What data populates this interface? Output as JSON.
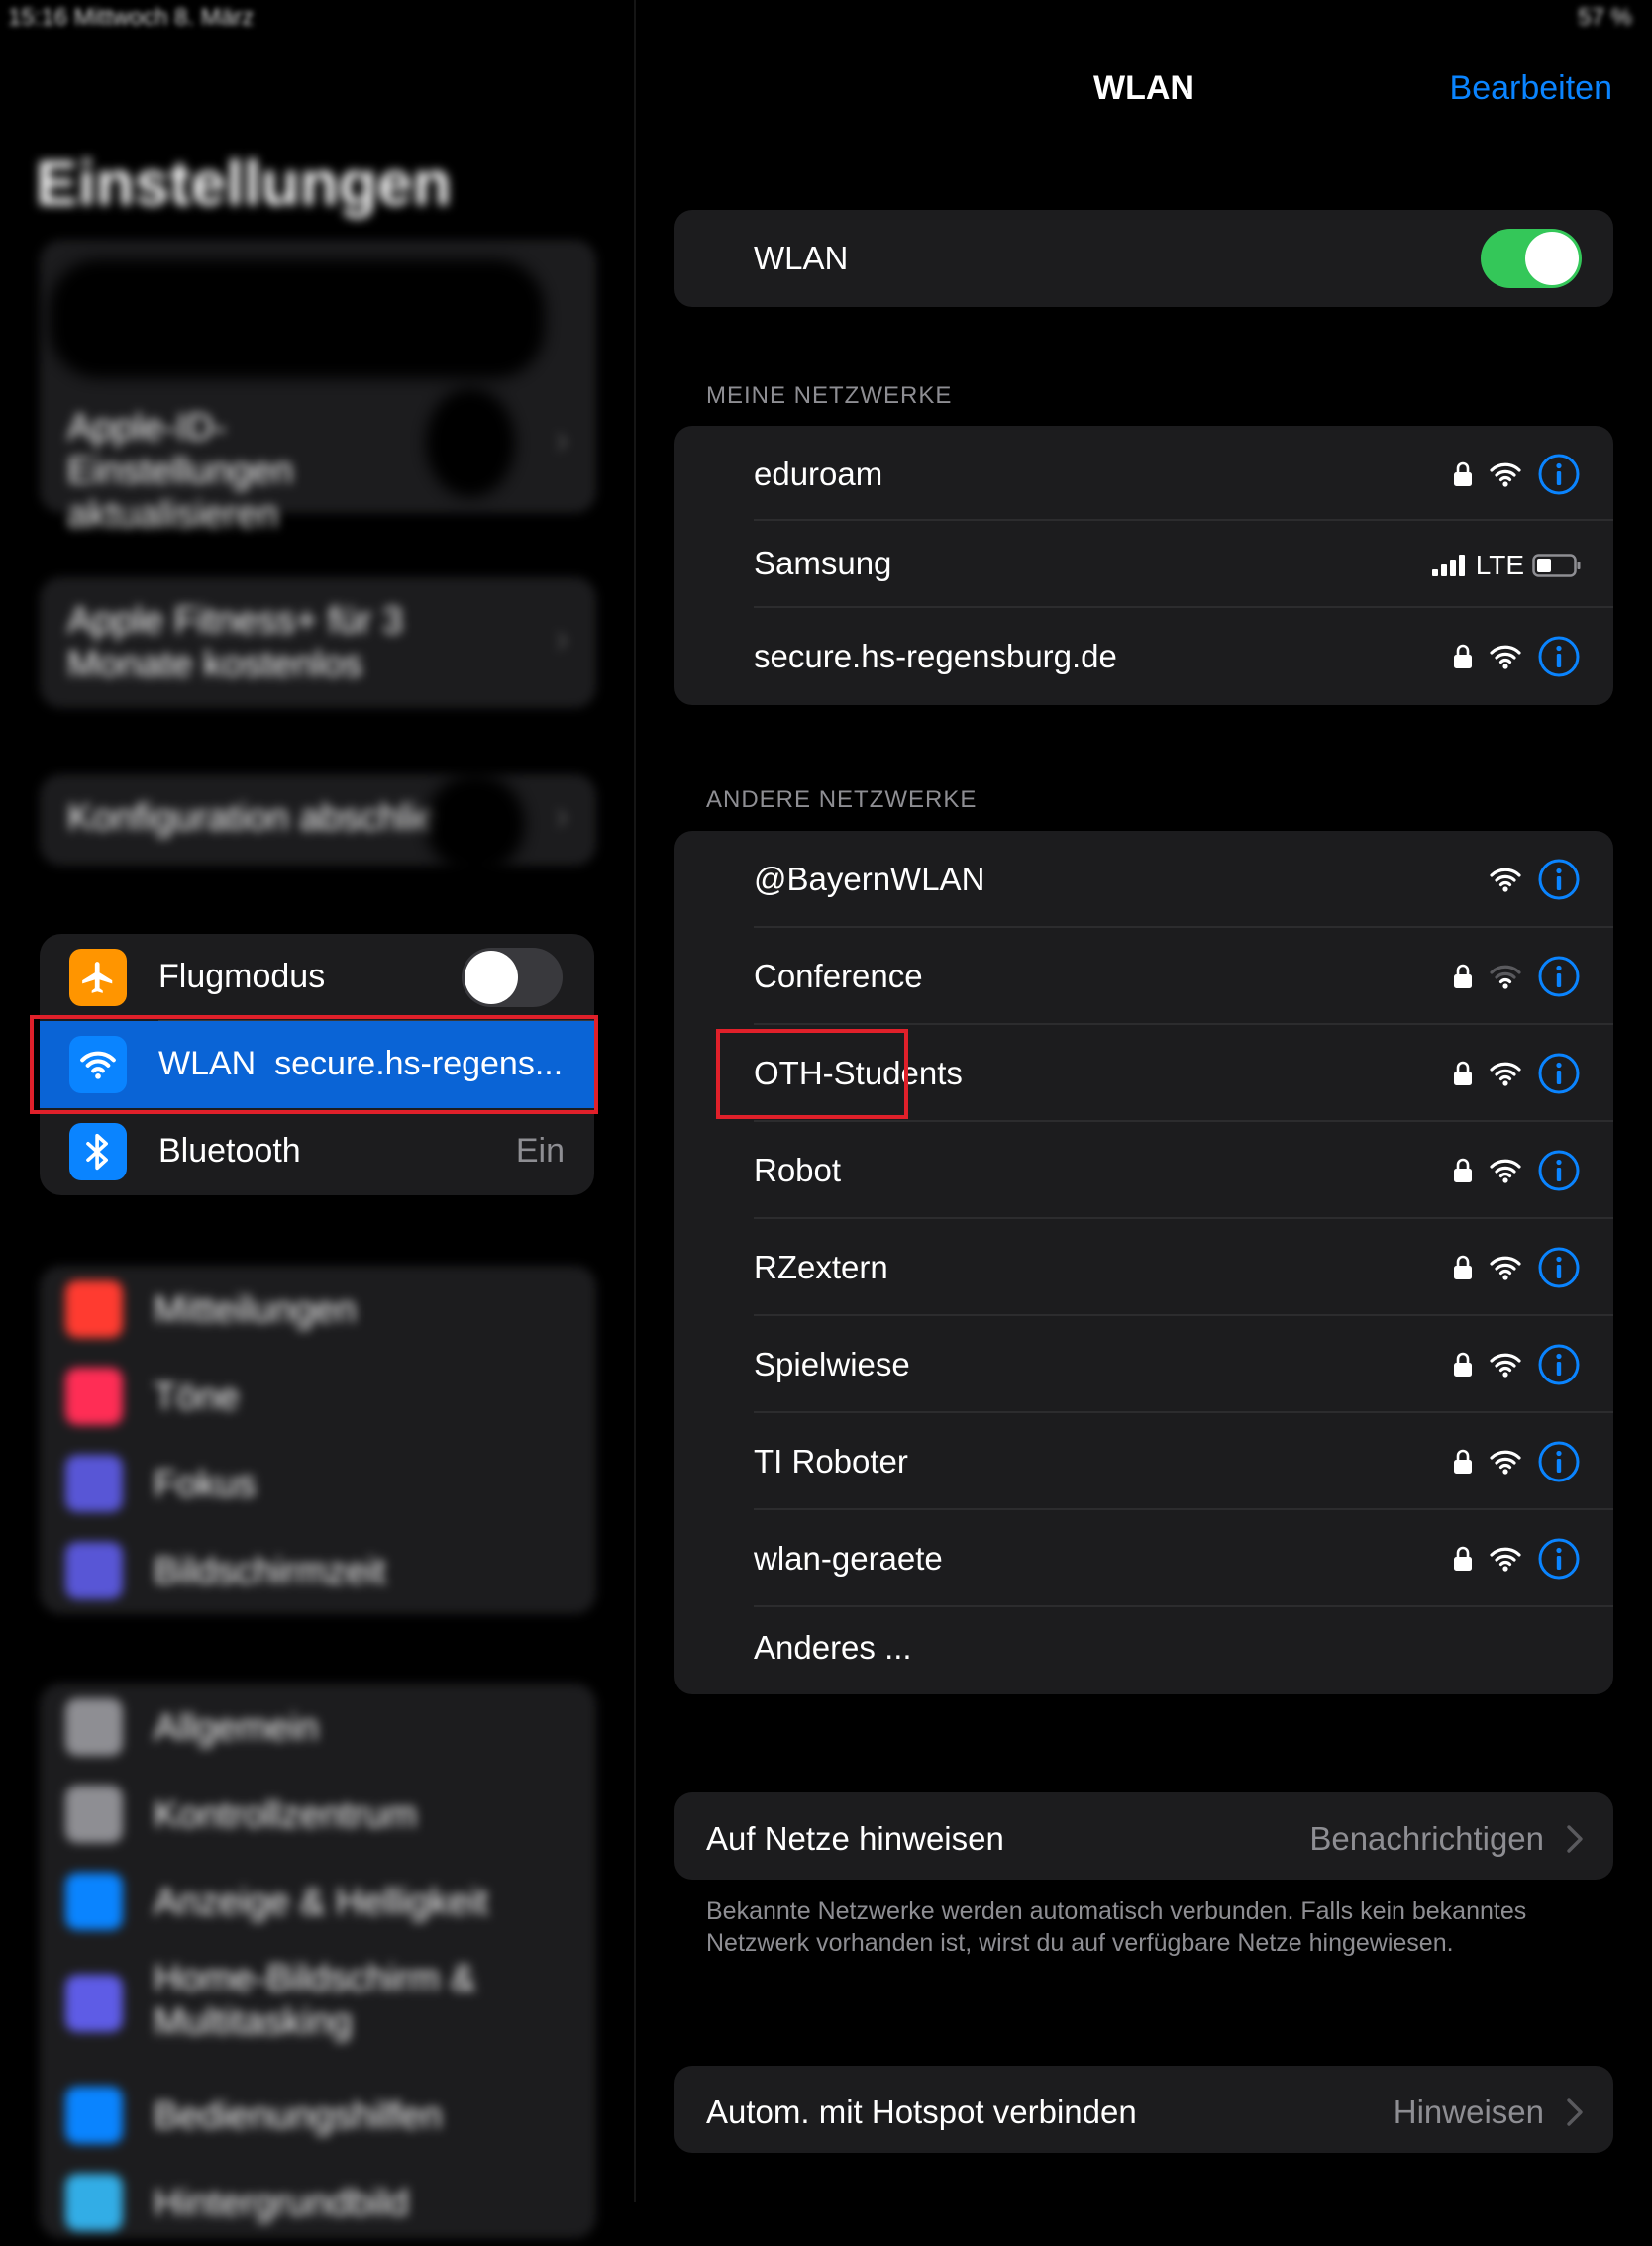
{
  "status_bar": {
    "left": "15:16  Mittwoch 8. März",
    "right": "57 %"
  },
  "left_panel": {
    "title": "Einstellungen",
    "apple_id_hint": "Apple-ID-Einstellungen aktualisieren",
    "fitness_offer": "Apple Fitness+ für 3 Monate kostenlos",
    "config_hint": "Konfiguration abschlie...",
    "connectivity": [
      {
        "name": "airplane",
        "label": "Flugmodus",
        "icon": "airplane-icon",
        "color": "#ff9500",
        "toggle": false
      },
      {
        "name": "wlan",
        "label": "WLAN",
        "value": "secure.hs-regens...",
        "icon": "wifi-icon",
        "color": "#0a84ff",
        "selected": true
      },
      {
        "name": "bluetooth",
        "label": "Bluetooth",
        "value": "Ein",
        "icon": "bluetooth-icon",
        "color": "#0a84ff"
      }
    ],
    "group_notifications": [
      {
        "label": "Mitteilungen",
        "color": "#ff3b30"
      },
      {
        "label": "Töne",
        "color": "#ff2d55"
      },
      {
        "label": "Fokus",
        "color": "#5856d6"
      },
      {
        "label": "Bildschirmzeit",
        "color": "#5856d6"
      }
    ],
    "group_general": [
      {
        "label": "Allgemein",
        "color": "#8e8e93"
      },
      {
        "label": "Kontrollzentrum",
        "color": "#8e8e93"
      },
      {
        "label": "Anzeige & Helligkeit",
        "color": "#0a84ff"
      },
      {
        "label": "Home-Bildschirm & Multitasking",
        "color": "#5e5ce6"
      },
      {
        "label": "Bedienungshilfen",
        "color": "#0a84ff"
      },
      {
        "label": "Hintergrundbild",
        "color": "#32ade6"
      }
    ]
  },
  "right_panel": {
    "nav_title": "WLAN",
    "edit_label": "Bearbeiten",
    "wlan_toggle": {
      "label": "WLAN",
      "on": true
    },
    "my_networks_header": "MEINE NETZWERKE",
    "my_networks": [
      {
        "name": "eduroam",
        "locked": true,
        "signal": 3,
        "info": true
      },
      {
        "name": "Samsung",
        "hotspot": true,
        "cell": "LTE",
        "battery": 0.3
      },
      {
        "name": "secure.hs-regensburg.de",
        "locked": true,
        "signal": 3,
        "info": true
      }
    ],
    "other_networks_header": "ANDERE NETZWERKE",
    "other_networks": [
      {
        "name": "@BayernWLAN",
        "locked": false,
        "signal": 3
      },
      {
        "name": "Conference",
        "locked": true,
        "signal": 1
      },
      {
        "name": "OTH-Students",
        "locked": true,
        "signal": 3,
        "highlight": true
      },
      {
        "name": "Robot",
        "locked": true,
        "signal": 3
      },
      {
        "name": "RZextern",
        "locked": true,
        "signal": 3
      },
      {
        "name": "Spielwiese",
        "locked": true,
        "signal": 3
      },
      {
        "name": "TI Roboter",
        "locked": true,
        "signal": 3
      },
      {
        "name": "wlan-geraete",
        "locked": true,
        "signal": 3
      }
    ],
    "other_label": "Anderes ...",
    "ask_join": {
      "label": "Auf Netze hinweisen",
      "value": "Benachrichtigen"
    },
    "ask_join_footer": "Bekannte Netzwerke werden automatisch verbunden. Falls kein bekanntes Netzwerk vorhanden ist, wirst du auf verfügbare Netze hingewiesen.",
    "hotspot": {
      "label": "Autom. mit Hotspot verbinden",
      "value": "Hinweisen"
    }
  },
  "colors": {
    "accent": "#0a84ff",
    "toggle_on": "#34c759",
    "selected_row": "#0a64d6",
    "highlight_box": "#e0202a"
  }
}
